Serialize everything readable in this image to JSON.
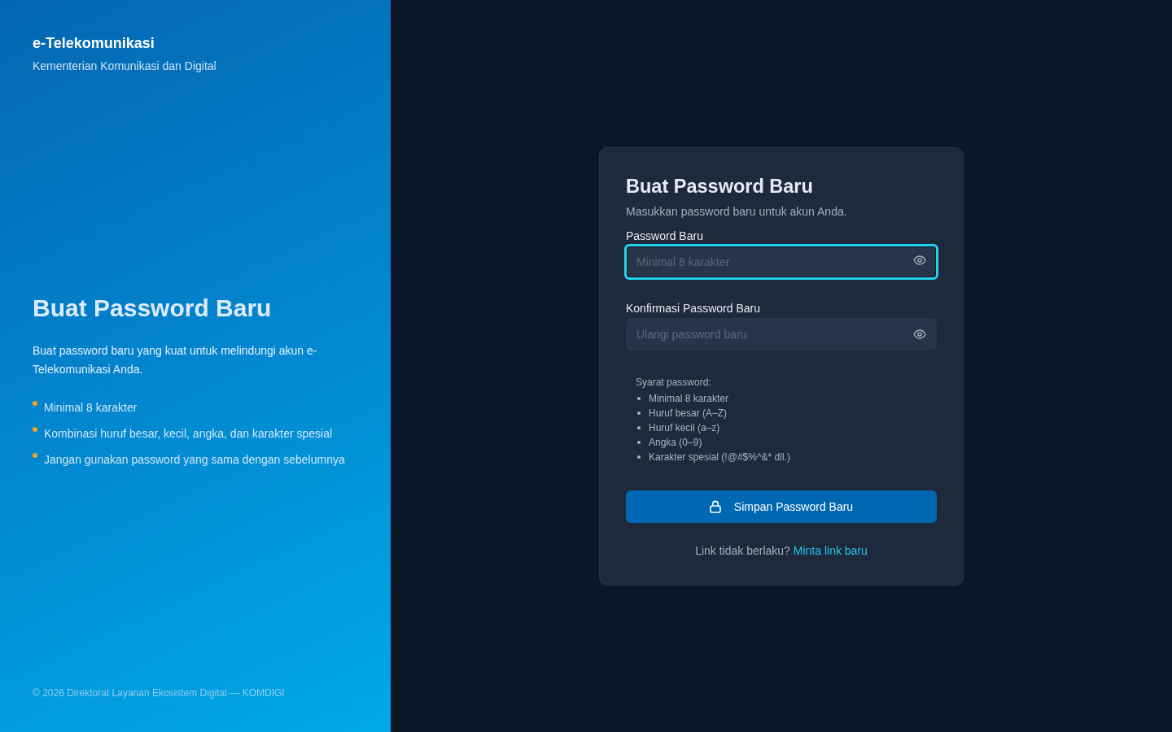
{
  "brand": {
    "title": "e-Telekomunikasi",
    "subtitle": "Kementerian Komunikasi dan Digital"
  },
  "hero": {
    "title": "Buat Password Baru",
    "description": "Buat password baru yang kuat untuk melindungi akun e-Telekomunikasi Anda.",
    "points": [
      "Minimal 8 karakter",
      "Kombinasi huruf besar, kecil, angka, dan karakter spesial",
      "Jangan gunakan password yang sama dengan sebelumnya"
    ]
  },
  "footer": "© 2026 Direktorat Layanan Ekosistem Digital — KOMDIGI",
  "form": {
    "title": "Buat Password Baru",
    "subtitle": "Masukkan password baru untuk akun Anda.",
    "fields": [
      {
        "label": "Password Baru",
        "placeholder": "Minimal 8 karakter",
        "focused": true
      },
      {
        "label": "Konfirmasi Password Baru",
        "placeholder": "Ulangi password baru",
        "focused": false
      }
    ],
    "requirements": {
      "title": "Syarat password:",
      "items": [
        "Minimal 8 karakter",
        "Huruf besar (A–Z)",
        "Huruf kecil (a–z)",
        "Angka (0–9)",
        "Karakter spesial (!@#$%^&* dll.)"
      ]
    },
    "submit_button": "Simpan Password Baru",
    "help": {
      "text": "Link tidak berlaku?",
      "link": "Minta link baru"
    }
  }
}
